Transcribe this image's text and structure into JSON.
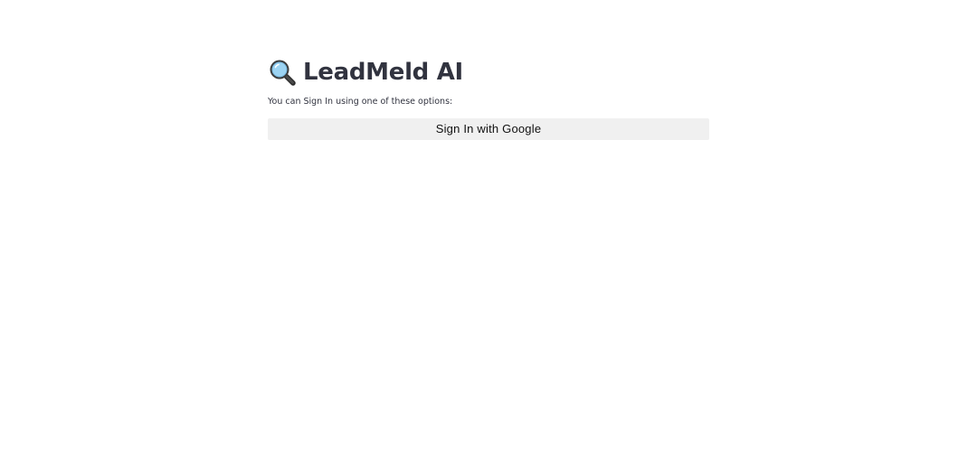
{
  "app": {
    "title": "LeadMeld AI",
    "logo_icon": "magnifying-glass-icon"
  },
  "signin": {
    "prompt": "You can Sign In using one of these options:",
    "google_button_label": "Sign In with Google"
  },
  "colors": {
    "background": "#ffffff",
    "title_text": "#31333f",
    "button_background": "#f0f0f0",
    "button_text": "#111111"
  }
}
